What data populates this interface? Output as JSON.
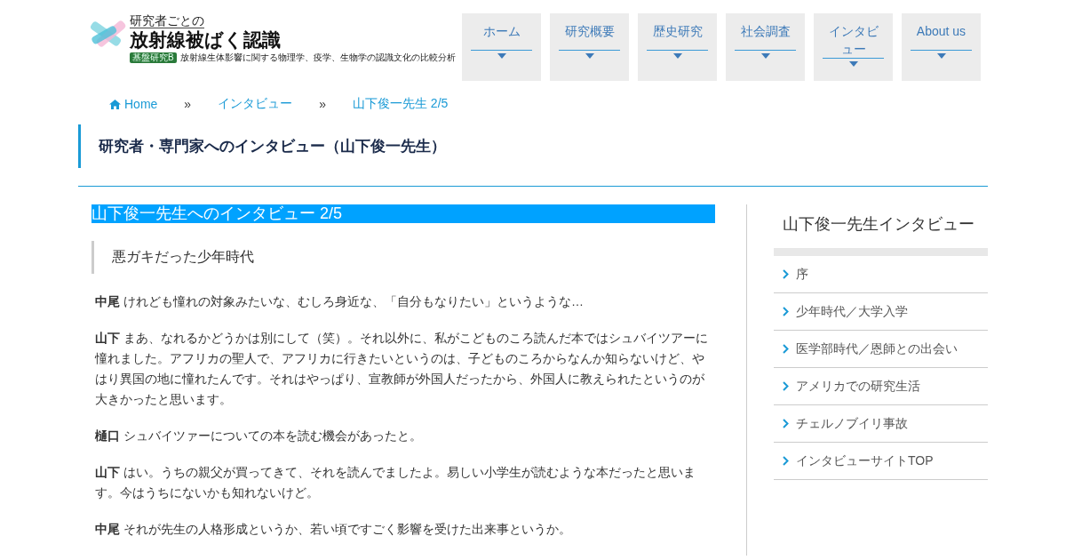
{
  "logo": {
    "subtitle": "研究者ごとの",
    "title": "放射線被ばく認識",
    "badge": "基盤研究B",
    "tagline": "放射線生体影響に関する物理学、疫学、生物学の認識文化の比較分析"
  },
  "nav": [
    {
      "label": "ホーム"
    },
    {
      "label": "研究概要"
    },
    {
      "label": "歴史研究"
    },
    {
      "label": "社会調査"
    },
    {
      "label": "インタビュー"
    },
    {
      "label": "About us"
    }
  ],
  "breadcrumb": [
    {
      "label": "Home",
      "kind": "home"
    },
    {
      "label": "»",
      "kind": "sep"
    },
    {
      "label": "インタビュー",
      "kind": "link"
    },
    {
      "label": "»",
      "kind": "sep"
    },
    {
      "label": "山下俊一先生 2/5",
      "kind": "link"
    }
  ],
  "page_title": "研究者・専門家へのインタビュー（山下俊一先生）",
  "article": {
    "heading": "山下俊一先生へのインタビュー 2/5",
    "section": "悪ガキだった少年時代",
    "paragraphs": [
      "**中尾** けれども憧れの対象みたいな、むしろ身近な、「自分もなりたい」というような…",
      "**山下** まあ、なれるかどうかは別にして（笑）。それ以外に、私がこどものころ読んだ本ではシュバイツアーに憧れました。アフリカの聖人で、アフリカに行きたいというのは、子どものころからなんか知らないけど、やはり異国の地に憧れたんです。それはやっぱり、宣教師が外国人だったから、外国人に教えられたというのが大きかったと思います。",
      "**樋口** シュバイツァーについての本を読む機会があったと。",
      "**山下** はい。うちの親父が買ってきて、それを読んでましたよ。易しい小学生が読むような本だったと思います。今はうちにないかも知れないけど。",
      "**中尾** それが先生の人格形成というか、若い頃ですごく影響を受けた出来事というか。"
    ]
  },
  "sidebar": {
    "title": "山下俊一先生インタビュー",
    "items": [
      {
        "label": "序"
      },
      {
        "label": "少年時代／大学入学"
      },
      {
        "label": "医学部時代／恩師との出会い"
      },
      {
        "label": "アメリカでの研究生活"
      },
      {
        "label": "チェルノブイリ事故"
      },
      {
        "label": "インタビューサイトTOP"
      }
    ]
  }
}
